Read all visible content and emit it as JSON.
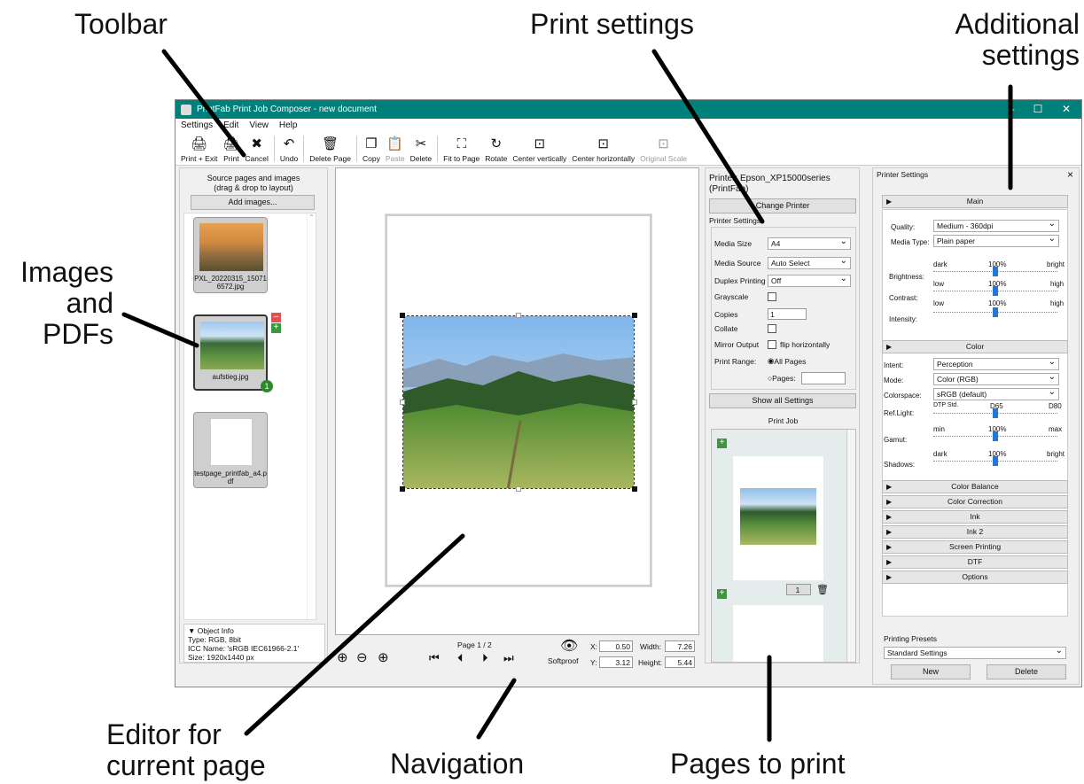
{
  "annotations": {
    "toolbar": "Toolbar",
    "print_settings": "Print settings",
    "additional": "Additional settings",
    "images": "Images and PDFs",
    "editor": "Editor for current page",
    "navigation": "Navigation",
    "pages": "Pages to print"
  },
  "window": {
    "title": "PrintFab Print Job Composer - new document"
  },
  "menu": [
    "Settings",
    "Edit",
    "View",
    "Help"
  ],
  "toolbar": [
    {
      "label": "Print + Exit",
      "icon": "🖨",
      "disabled": false
    },
    {
      "label": "Print",
      "icon": "🖨",
      "disabled": false
    },
    {
      "label": "Cancel",
      "icon": "✖",
      "disabled": false
    },
    {
      "label": "Undo",
      "icon": "↶",
      "disabled": false
    },
    {
      "label": "Delete Page",
      "icon": "🗑",
      "disabled": false
    },
    {
      "label": "Copy",
      "icon": "❐",
      "disabled": false
    },
    {
      "label": "Paste",
      "icon": "📋",
      "disabled": true
    },
    {
      "label": "Delete",
      "icon": "✂",
      "disabled": false
    },
    {
      "label": "Fit to Page",
      "icon": "⛶",
      "disabled": false
    },
    {
      "label": "Rotate",
      "icon": "↻",
      "disabled": false
    },
    {
      "label": "Center vertically",
      "icon": "⊡",
      "disabled": false
    },
    {
      "label": "Center horizontally",
      "icon": "⊡",
      "disabled": false
    },
    {
      "label": "Original Scale",
      "icon": "⊡",
      "disabled": true
    }
  ],
  "left": {
    "header": "Source pages and images\n(drag & drop to layout)",
    "add_button": "Add images...",
    "thumbs": [
      {
        "caption": "PXL_20220315_150716572.jpg"
      },
      {
        "caption": "aufstieg.jpg",
        "badge": "1"
      },
      {
        "caption": "testpage_printfab_a4.pdf"
      }
    ],
    "objinfo": {
      "title": "Object Info",
      "type": "Type: RGB, 8bit",
      "icc": "ICC Name: 'sRGB IEC61966-2.1'",
      "size": "Size: 1920x1440 px"
    }
  },
  "nav": {
    "page": "Page 1 / 2",
    "softproof": "Softproof",
    "x_label": "X:",
    "x": "0.50",
    "y_label": "Y:",
    "y": "3.12",
    "w_label": "Width:",
    "w": "7.26",
    "h_label": "Height:",
    "h": "5.44"
  },
  "printer": {
    "name": "Printer: Epson_XP15000series (PrintFab)",
    "change": "Change Printer",
    "settings_label": "Printer Settings:",
    "media_size_label": "Media Size",
    "media_size": "A4",
    "media_source_label": "Media Source",
    "media_source": "Auto Select",
    "duplex_label": "Duplex Printing",
    "duplex": "Off",
    "grayscale": "Grayscale",
    "copies_label": "Copies",
    "copies": "1",
    "collate": "Collate",
    "mirror_label": "Mirror Output",
    "mirror": "flip horizontally",
    "range_label": "Print Range:",
    "all_pages": "All Pages",
    "pages": "Pages:",
    "show_all": "Show all Settings",
    "job_title": "Print Job",
    "job_count": "1"
  },
  "right": {
    "title": "Printer Settings",
    "close": "×",
    "main": "Main",
    "quality_label": "Quality:",
    "quality": "Medium - 360dpi",
    "media_type_label": "Media Type:",
    "media_type": "Plain paper",
    "brightness": "Brightness:",
    "contrast": "Contrast:",
    "intensity": "Intensity:",
    "dark": "dark",
    "bright": "bright",
    "low": "low",
    "high": "high",
    "pct": "100%",
    "color": "Color",
    "intent_label": "Intent:",
    "intent": "Perception",
    "mode_label": "Mode:",
    "mode": "Color (RGB)",
    "cs_label": "Colorspace:",
    "cs": "sRGB (default)",
    "reflight": "Ref.Light:",
    "dtp": "DTP Std.",
    "d65": "D65",
    "d80": "D80",
    "gamut": "Gamut:",
    "min": "min",
    "max": "max",
    "shadows": "Shadows:",
    "sections": [
      "Color Balance",
      "Color Correction",
      "Ink",
      "Ink 2",
      "Screen Printing",
      "DTF",
      "Options"
    ],
    "presets_label": "Printing Presets",
    "preset": "Standard Settings",
    "new": "New",
    "delete": "Delete"
  }
}
